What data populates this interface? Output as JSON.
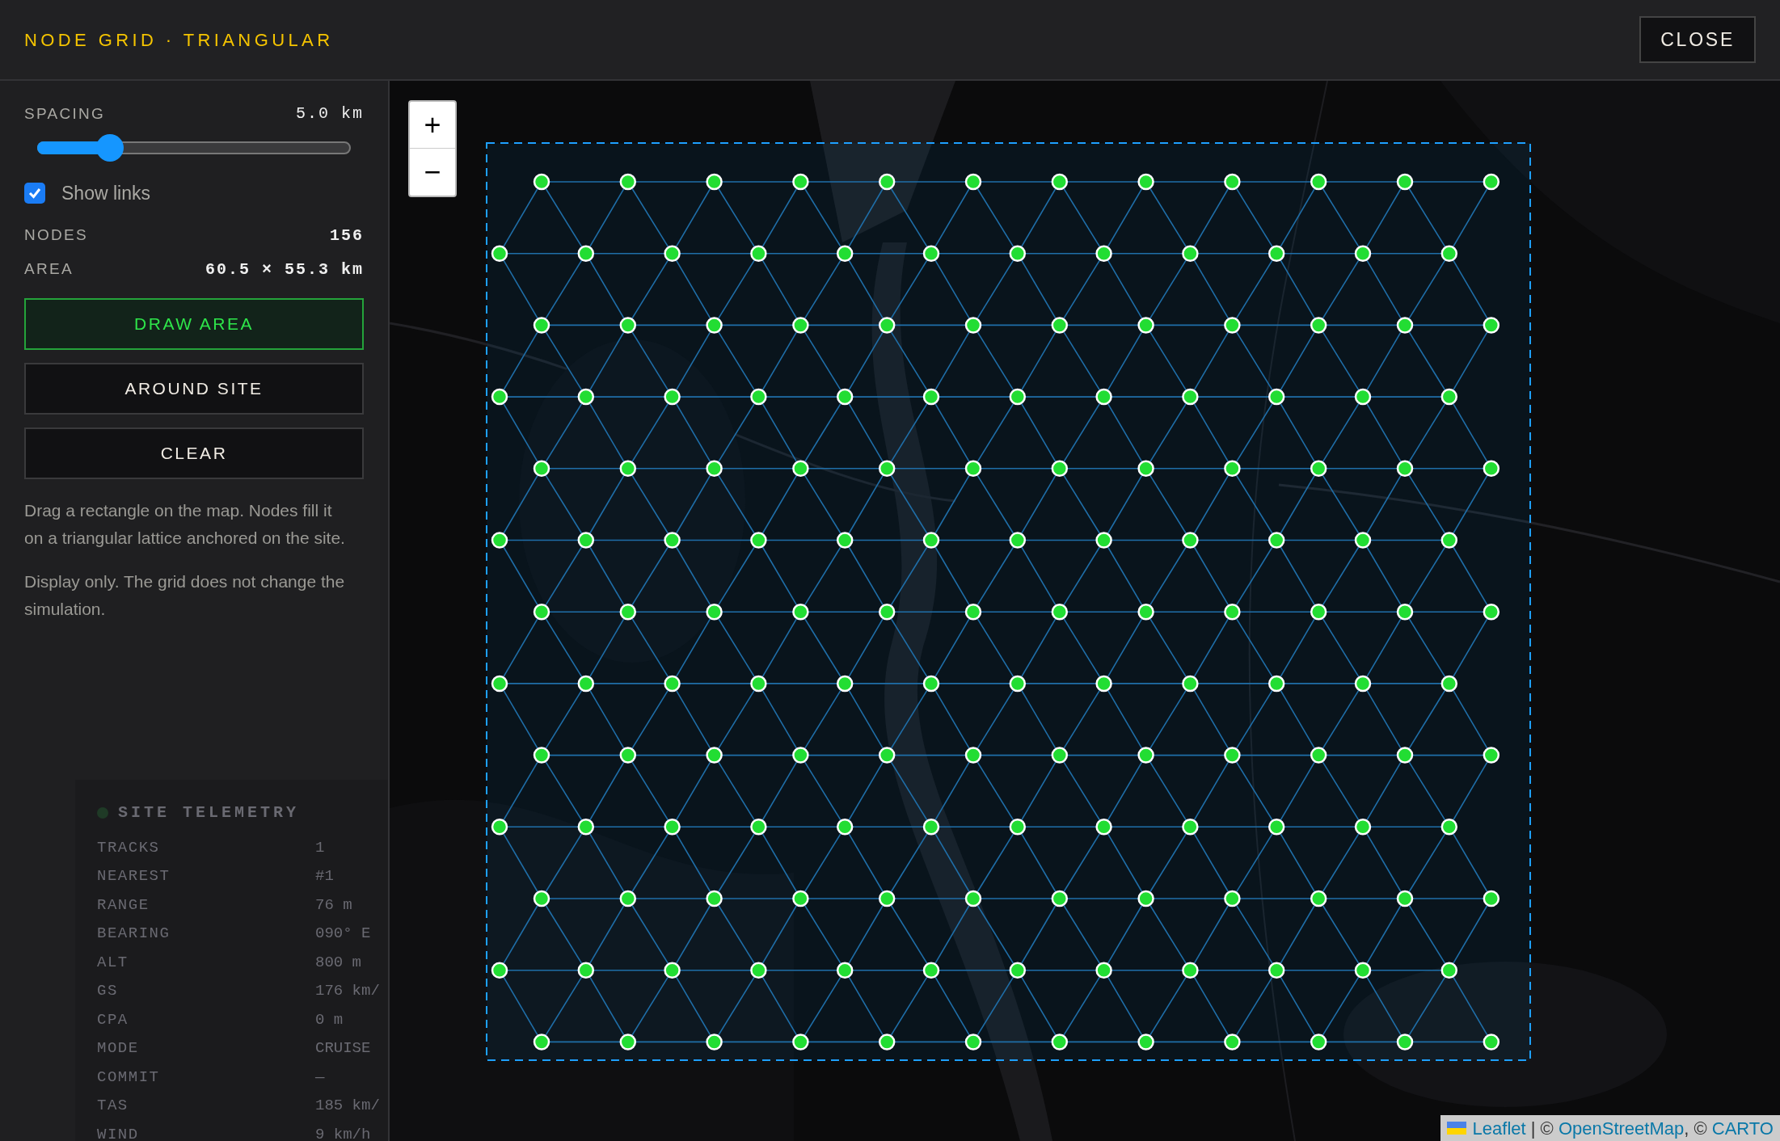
{
  "header": {
    "title": "NODE GRID · TRIANGULAR",
    "close": "CLOSE"
  },
  "panel": {
    "spacing": {
      "label": "SPACING",
      "value": "5.0 km",
      "level": 0.23
    },
    "show_links": {
      "label": "Show links",
      "checked": true
    },
    "stats": [
      {
        "label": "NODES",
        "value": "156"
      },
      {
        "label": "AREA",
        "value": "60.5 × 55.3 km"
      }
    ],
    "buttons": [
      {
        "label": "DRAW AREA",
        "selected": true
      },
      {
        "label": "AROUND SITE",
        "selected": false
      },
      {
        "label": "CLEAR",
        "selected": false
      }
    ],
    "notes": [
      "Drag a rectangle on the map. Nodes fill it on a triangular lattice anchored on the site.",
      "Display only. The grid does not change the simulation."
    ]
  },
  "background_telemetry": {
    "title": "SITE TELEMETRY",
    "rows": [
      {
        "label": "TRACKS",
        "value": "1"
      },
      {
        "label": "NEAREST",
        "value": "#1"
      },
      {
        "label": "RANGE",
        "value": "76 m"
      },
      {
        "label": "BEARING",
        "value": "090° E"
      },
      {
        "label": "ALT",
        "value": "800 m"
      },
      {
        "label": "GS",
        "value": "176 km/"
      },
      {
        "label": "CPA",
        "value": "0 m"
      },
      {
        "label": "MODE",
        "value": "CRUISE"
      },
      {
        "label": "COMMIT",
        "value": "—"
      },
      {
        "label": "TAS",
        "value": "185 km/"
      },
      {
        "label": "WIND",
        "value": "9 km/h"
      }
    ]
  },
  "map": {
    "zoom_in": "+",
    "zoom_out": "−",
    "attribution": [
      {
        "text": "Leaflet",
        "link": true
      },
      {
        "text": " | © ",
        "link": false
      },
      {
        "text": "OpenStreetMap",
        "link": true
      },
      {
        "text": ", © ",
        "link": false
      },
      {
        "text": "CARTO",
        "link": true
      }
    ]
  }
}
